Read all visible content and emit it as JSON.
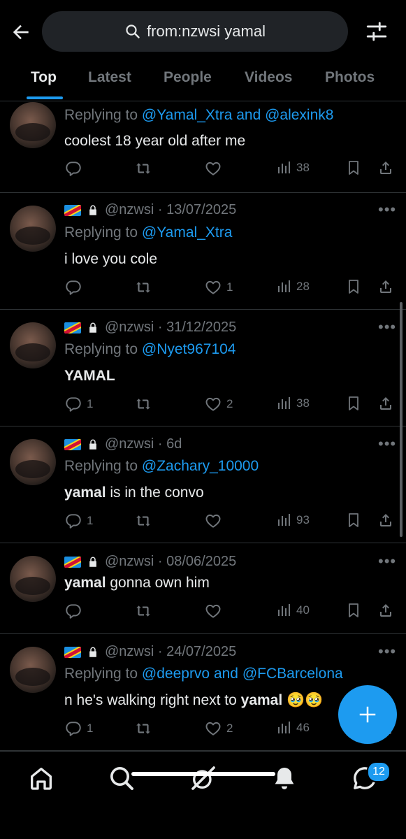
{
  "search": {
    "query": "from:nzwsi yamal"
  },
  "tabs": [
    "Top",
    "Latest",
    "People",
    "Videos",
    "Photos"
  ],
  "tweets": [
    {
      "handle": "",
      "date": "",
      "reply_prefix": "Replying to ",
      "reply_to": "@Yamal_Xtra and @alexink8",
      "text_parts": [
        {
          "t": "coolest 18 year old after me",
          "b": false
        }
      ],
      "replies": "",
      "likes": "",
      "views": "38"
    },
    {
      "handle": "@nzwsi",
      "date": "· 13/07/2025",
      "reply_prefix": "Replying to ",
      "reply_to": "@Yamal_Xtra",
      "text_parts": [
        {
          "t": "i love you cole",
          "b": false
        }
      ],
      "replies": "",
      "likes": "1",
      "views": "28"
    },
    {
      "handle": "@nzwsi",
      "date": "· 31/12/2025",
      "reply_prefix": "Replying to ",
      "reply_to": "@Nyet967104",
      "text_parts": [
        {
          "t": "YAMAL",
          "b": true
        }
      ],
      "replies": "1",
      "likes": "2",
      "views": "38"
    },
    {
      "handle": "@nzwsi",
      "date": "· 6d",
      "reply_prefix": "Replying to ",
      "reply_to": "@Zachary_10000",
      "text_parts": [
        {
          "t": "yamal",
          "b": true
        },
        {
          "t": " is in the convo",
          "b": false
        }
      ],
      "replies": "1",
      "likes": "",
      "views": "93"
    },
    {
      "handle": "@nzwsi",
      "date": "· 08/06/2025",
      "reply_prefix": "",
      "reply_to": "",
      "text_parts": [
        {
          "t": "yamal",
          "b": true
        },
        {
          "t": " gonna own him",
          "b": false
        }
      ],
      "replies": "",
      "likes": "",
      "views": "40"
    },
    {
      "handle": "@nzwsi",
      "date": "· 24/07/2025",
      "reply_prefix": "Replying to ",
      "reply_to": "@deeprvo and @FCBarcelona",
      "text_parts": [
        {
          "t": "n he's walking right next to ",
          "b": false
        },
        {
          "t": "yamal",
          "b": true
        },
        {
          "t": " 🥹🥹",
          "b": false
        }
      ],
      "replies": "1",
      "likes": "2",
      "views": "46"
    }
  ],
  "nav": {
    "messages_badge": "12"
  },
  "colors": {
    "accent": "#1d9bf0",
    "background": "#000000",
    "muted": "#71767b",
    "text": "#e7e9ea"
  }
}
